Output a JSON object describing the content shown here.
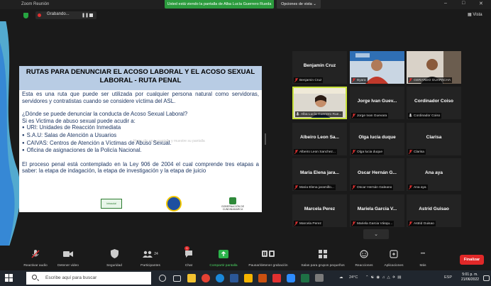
{
  "window": {
    "app_title": "Zoom Reunión",
    "share_banner": "Usted está viendo la pantalla de Alba Lucía Guerrero Rueda",
    "view_options": "Opciones de vista ⌄",
    "minimize": "–",
    "maximize": "□",
    "close": "✕"
  },
  "recording": {
    "label": "Grabando...",
    "pause": "❚❚",
    "view_button": "▦ Vista"
  },
  "slide": {
    "title_line1": "RUTAS PARA DENUNCIAR EL ACOSO LABORAL Y EL ACOSO SEXUAL",
    "title_line2": "LABORAL - RUTA PENAL",
    "intro": "Esta es una ruta que puede ser utilizada por cualquier persona natural como servidoras, servidores y contratistas cuando se considere víctima del ASL.",
    "question": "¿Dónde se puede denunciar la conducta de Acoso Sexual Laboral?",
    "victim_line": "Si es Victima de abuso sexual puede acudir a:",
    "bullets": [
      "URI: Unidades de Reacción Inmediata",
      "S.A.U: Salas de Atención a Usuarios",
      "CAIVAS: Centros de Atención a Víctimas de Abuso Sexual.",
      "Oficina de asignaciones de la Policía Nacional."
    ],
    "closing": "El proceso penal está contemplado en la Ley 906 de 2004 el cual comprende tres etapas a saber: la etapa de indagación, la etapa de investigación y la etapa de juicio",
    "logo1_text": "Intraudal",
    "logo3_text": "GOBERNACIÓN DE CUNDINAMARCA",
    "faded_caption": "Haga clic en la pantalla y muestre su pantalla"
  },
  "participants": [
    {
      "center_name": "Benjamin Cruz",
      "label": "Benjamin Cruz",
      "muted": true,
      "video": false
    },
    {
      "center_name": "",
      "label": "Byara",
      "muted": true,
      "video": true,
      "photo": "man-red-shirt"
    },
    {
      "center_name": "",
      "label": "GERARDO GUAPACHA",
      "muted": true,
      "video": true,
      "photo": "man-dark-shirt"
    },
    {
      "center_name": "",
      "label": "Alba Lucía Guerrero Rue...",
      "muted": false,
      "video": true,
      "photo": "woman-speaker",
      "active": true
    },
    {
      "center_name": "Jorge Ivan Guev...",
      "label": "Jorge Ivan Guevara",
      "muted": true,
      "video": false
    },
    {
      "center_name": "Cordinador Coiso",
      "label": "Cordinador Coiso",
      "muted": false,
      "video": false
    },
    {
      "center_name": "Albeiro Leon Sa...",
      "label": "Albeiro Leon Sanchez...",
      "muted": true,
      "video": false
    },
    {
      "center_name": "Olga lucia duque",
      "label": "Olga lucia duque",
      "muted": true,
      "video": false
    },
    {
      "center_name": "Clarisa",
      "label": "Clarisa",
      "muted": true,
      "video": false
    },
    {
      "center_name": "Maria Elena jara...",
      "label": "Maria Elena jaramillo...",
      "muted": true,
      "video": false
    },
    {
      "center_name": "Oscar Hernán G...",
      "label": "Oscar Hernán Galeano",
      "muted": true,
      "video": false
    },
    {
      "center_name": "Ana aya",
      "label": "Ana aya",
      "muted": true,
      "video": false
    },
    {
      "center_name": "Marcela Perez",
      "label": "Marcela Perez",
      "muted": true,
      "video": false
    },
    {
      "center_name": "Mariela Garcia V...",
      "label": "Mariela Garcia Vásqu...",
      "muted": true,
      "video": false
    },
    {
      "center_name": "Astrid Guisao",
      "label": "Astrid Guisao",
      "muted": true,
      "video": false
    }
  ],
  "gallery": {
    "more_chevron": "⌄"
  },
  "toolbar": {
    "audio": "Reactivar audio",
    "video": "Detener video",
    "security": "Seguridad",
    "participants": "Participantes",
    "participants_count": "24",
    "chat": "Chat",
    "chat_badge": "1",
    "share": "Compartir pantalla",
    "record": "Pausar/detener grabación",
    "breakout": "Salas para grupos pequeños",
    "reactions": "Reacciones",
    "apps": "Aplicaciones",
    "more": "Más",
    "more_dots": "•••",
    "leave": "Finalizar"
  },
  "taskbar": {
    "search_placeholder": "Escribe aquí para buscar",
    "weather": "24°C",
    "lang": "ESP",
    "time": "5:01 p. m.",
    "date": "21/06/2022"
  },
  "colors": {
    "share_green": "#2b9b3d",
    "slide_header": "#b8cce4",
    "slide_text": "#1f3864",
    "active_speaker": "#c8e23a",
    "leave_red": "#e02828",
    "muted_red": "#e03030"
  }
}
